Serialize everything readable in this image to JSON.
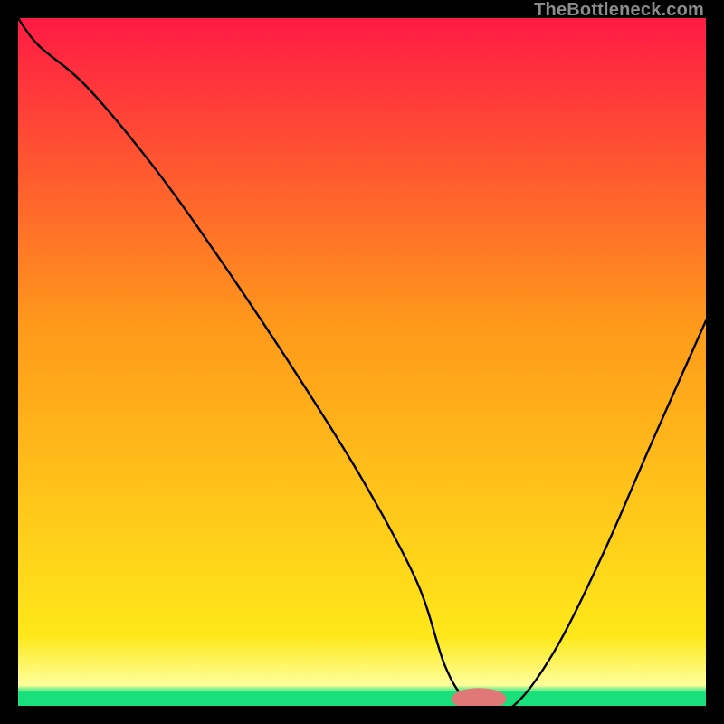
{
  "watermark": "TheBottleneck.com",
  "colors": {
    "red": "#ff1a44",
    "orange": "#ff9a1a",
    "yellow": "#ffe81a",
    "pale_yellow": "#ffff9a",
    "green": "#18e07a",
    "curve": "#000000",
    "marker": "#e07878",
    "bg": "#000000"
  },
  "chart_data": {
    "type": "line",
    "title": "",
    "xlabel": "",
    "ylabel": "",
    "xlim": [
      0,
      100
    ],
    "ylim": [
      0,
      100
    ],
    "gradient_stops_y": [
      {
        "pos": 0,
        "color": "#18e07a"
      },
      {
        "pos": 2,
        "color": "#18e07a"
      },
      {
        "pos": 3,
        "color": "#ffff9a"
      },
      {
        "pos": 10,
        "color": "#ffe81a"
      },
      {
        "pos": 55,
        "color": "#ff9a1a"
      },
      {
        "pos": 100,
        "color": "#ff1a44"
      }
    ],
    "series": [
      {
        "name": "bottleneck-curve",
        "x": [
          0,
          3,
          10,
          20,
          30,
          40,
          50,
          58,
          62,
          65,
          68,
          72,
          78,
          85,
          92,
          100
        ],
        "y": [
          100,
          96,
          90,
          78,
          64,
          49,
          33,
          18,
          6,
          1,
          0,
          0,
          8,
          22,
          38,
          56
        ]
      }
    ],
    "marker": {
      "x": 67,
      "y": 1,
      "rx": 4,
      "ry": 1.6
    }
  }
}
